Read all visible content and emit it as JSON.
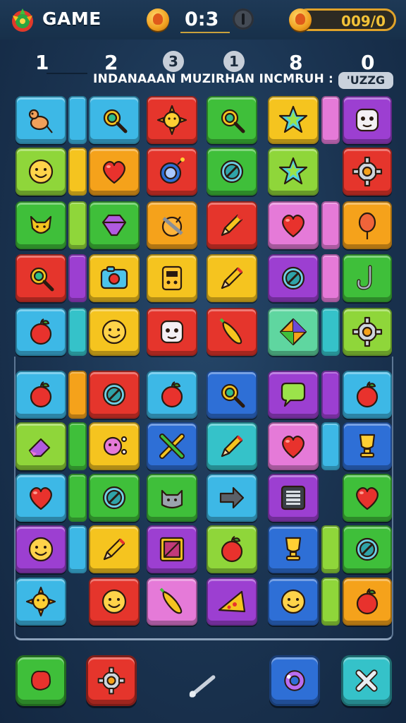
{
  "header": {
    "title": "GAME",
    "timer": "0:3",
    "score": "009/0"
  },
  "numbers_row": {
    "n1": "1",
    "n2": "2",
    "n3": "3",
    "n4": "1",
    "n5": "8",
    "n6": "0"
  },
  "subtitle": "INDANAAAN MUZIRHAN INCMRUH :",
  "badge": "'UZZG",
  "colors": {
    "cyan": "#3db8e6",
    "green": "#3fbf3a",
    "red": "#e5352c",
    "yellow": "#f5c41f",
    "orange": "#f5a21b",
    "purple": "#9c3fd1",
    "lime": "#8fd63a",
    "pink": "#e57ad8",
    "blue": "#2e6fd6",
    "teal": "#35c2c9",
    "seafoam": "#5fd6a0"
  },
  "board": {
    "tiles": [
      {
        "icon": "mouse-icon",
        "color": "cyan"
      },
      {
        "icon": "magnifier-icon",
        "color": "cyan"
      },
      {
        "icon": "sun-icon",
        "color": "red"
      },
      {
        "icon": "magnifier-icon",
        "color": "green"
      },
      {
        "icon": "star-icon",
        "color": "yellow"
      },
      {
        "icon": "face-icon",
        "color": "purple"
      },
      {
        "icon": "smiley-icon",
        "color": "lime"
      },
      {
        "icon": "heart-icon",
        "color": "orange"
      },
      {
        "icon": "bomb-icon",
        "color": "red"
      },
      {
        "icon": "ring-icon",
        "color": "green"
      },
      {
        "icon": "star-icon",
        "color": "lime"
      },
      {
        "icon": "gear-icon",
        "color": "red"
      },
      {
        "icon": "fox-icon",
        "color": "green"
      },
      {
        "icon": "gem-icon",
        "color": "green"
      },
      {
        "icon": "helmet-icon",
        "color": "orange"
      },
      {
        "icon": "pencil-icon",
        "color": "red"
      },
      {
        "icon": "heart-icon",
        "color": "pink"
      },
      {
        "icon": "balloon-icon",
        "color": "orange"
      },
      {
        "icon": "magnifier-icon",
        "color": "red"
      },
      {
        "icon": "camera-icon",
        "color": "yellow"
      },
      {
        "icon": "robot-icon",
        "color": "yellow"
      },
      {
        "icon": "pencil-icon",
        "color": "yellow"
      },
      {
        "icon": "ring-icon",
        "color": "purple"
      },
      {
        "icon": "hook-icon",
        "color": "green"
      },
      {
        "icon": "apple-icon",
        "color": "cyan"
      },
      {
        "icon": "smiley-icon",
        "color": "yellow"
      },
      {
        "icon": "face-icon",
        "color": "red"
      },
      {
        "icon": "pepper-icon",
        "color": "red"
      },
      {
        "icon": "diamond-icon",
        "color": "seafoam"
      },
      {
        "icon": "gear-icon",
        "color": "lime"
      },
      {
        "icon": "apple-icon",
        "color": "cyan"
      },
      {
        "icon": "ring-icon",
        "color": "red"
      },
      {
        "icon": "apple-icon",
        "color": "cyan"
      },
      {
        "icon": "magnifier-icon",
        "color": "blue"
      },
      {
        "icon": "bubble-icon",
        "color": "purple"
      },
      {
        "icon": "apple-icon",
        "color": "cyan"
      },
      {
        "icon": "eraser-icon",
        "color": "lime"
      },
      {
        "icon": "flower-icon",
        "color": "yellow"
      },
      {
        "icon": "cross-icon",
        "color": "blue"
      },
      {
        "icon": "pencil-icon",
        "color": "teal"
      },
      {
        "icon": "heart-icon",
        "color": "pink"
      },
      {
        "icon": "trophy-icon",
        "color": "blue"
      },
      {
        "icon": "heart-icon",
        "color": "cyan"
      },
      {
        "icon": "ring-icon",
        "color": "green"
      },
      {
        "icon": "cat-icon",
        "color": "green"
      },
      {
        "icon": "arrow-icon",
        "color": "cyan"
      },
      {
        "icon": "film-icon",
        "color": "purple"
      },
      {
        "icon": "heart-icon",
        "color": "green"
      },
      {
        "icon": "smiley-icon",
        "color": "purple"
      },
      {
        "icon": "pencil-icon",
        "color": "yellow"
      },
      {
        "icon": "frame-icon",
        "color": "purple"
      },
      {
        "icon": "apple-icon",
        "color": "lime"
      },
      {
        "icon": "trophy-icon",
        "color": "blue"
      },
      {
        "icon": "ring-icon",
        "color": "green"
      },
      {
        "icon": "sun-icon",
        "color": "cyan"
      },
      {
        "icon": "smiley-icon",
        "color": "red"
      },
      {
        "icon": "pepper-icon",
        "color": "pink"
      },
      {
        "icon": "pizza-icon",
        "color": "purple"
      },
      {
        "icon": "smiley-icon",
        "color": "blue"
      },
      {
        "icon": "apple-icon",
        "color": "orange"
      }
    ],
    "separators": [
      {
        "col": 0,
        "color": "cyan"
      },
      {
        "col": 2,
        "color": "purple"
      },
      {
        "col": 4,
        "color": "pink"
      },
      {
        "col": 0,
        "color": "yellow"
      },
      {
        "col": 4,
        "color": "lime"
      },
      {
        "col": 0,
        "color": "lime"
      },
      {
        "col": 4,
        "color": "pink"
      },
      {
        "col": 0,
        "color": "purple"
      },
      {
        "col": 4,
        "color": "pink"
      },
      {
        "col": 0,
        "color": "teal"
      },
      {
        "col": 4,
        "color": "teal"
      },
      {
        "col": 0,
        "color": "orange"
      },
      {
        "col": 4,
        "color": "purple"
      },
      {
        "col": 0,
        "color": "green"
      },
      {
        "col": 4,
        "color": "cyan"
      },
      {
        "col": 0,
        "color": "green"
      },
      {
        "col": 0,
        "color": "cyan"
      },
      {
        "col": 4,
        "color": "lime"
      },
      {
        "col": 4,
        "color": "lime"
      }
    ]
  },
  "bottom_bar": {
    "buttons": [
      {
        "icon": "blob-icon",
        "color": "green"
      },
      {
        "icon": "gear-icon",
        "color": "red"
      },
      {
        "icon": "wand-icon",
        "color": "none"
      },
      {
        "icon": "swap-icon",
        "color": "blue"
      },
      {
        "icon": "close-icon",
        "color": "teal"
      }
    ]
  }
}
